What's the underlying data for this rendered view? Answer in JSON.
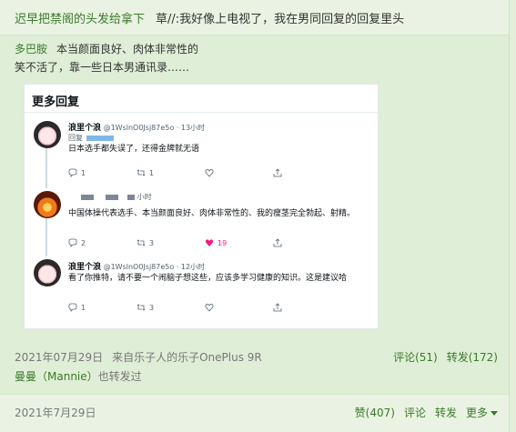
{
  "post": {
    "author": "迟早把禁阁的头发给拿下",
    "text": "草//:我好像上电视了，我在男同回复的回复里头"
  },
  "retweet": {
    "author": "多巴胺",
    "text_inline": "本当颜面良好、肉体非常性的",
    "text_line2": "笑不活了，靠一些日本男通讯录……",
    "screenshot": {
      "title": "更多回复",
      "tweets": [
        {
          "username": "浪里个浪",
          "handle": "@1WslnO0Jsj87e5o · 13小时",
          "reply_to": "回复",
          "body": "日本选手都失误了，还得金牌就无语",
          "reply_count": "1",
          "retweet_count": "1",
          "like_count": "",
          "liked": false
        },
        {
          "username": "",
          "handle": "小时",
          "reply_to": "",
          "body": "中国体操代表选手、本当颜面良好、肉体非常性的、我的瘦茎完全勃起、射精。",
          "reply_count": "2",
          "retweet_count": "3",
          "like_count": "19",
          "liked": true
        },
        {
          "username": "浪里个浪",
          "handle": "@1WslnO0Jsj87e5o · 12小时",
          "reply_to": "",
          "body": "看了你推特，请不要一个闹脑子想这些，应该多学习健康的知识。这是建议哈",
          "reply_count": "1",
          "retweet_count": "3",
          "like_count": "",
          "liked": false
        }
      ]
    },
    "time": "2021年07月29日",
    "source": "来自乐子人的乐子OnePlus 9R",
    "comment_label": "评论(51)",
    "repost_label": "转发(172)",
    "also_retweeted_by": "曼曼（Mannie）",
    "also_retweeted_suffix": "也转发过"
  },
  "footer": {
    "date": "2021年7月29日",
    "like_label": "赞(407)",
    "comment_label": "评论",
    "repost_label": "转发",
    "more_label": "更多"
  },
  "colors": {
    "background": "#eaf3e3",
    "retweet_bg": "#dfeed6",
    "link_green": "#3a7a2a",
    "like_pink": "#f91880"
  }
}
